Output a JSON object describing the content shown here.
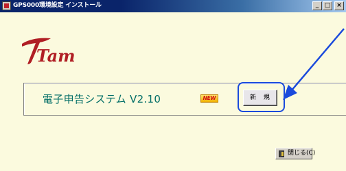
{
  "window": {
    "title": "GPS000環境設定 インストール",
    "minimize_glyph": "_",
    "maximize_glyph": "□",
    "close_glyph": "×"
  },
  "logo": {
    "text": "Tam",
    "color": "#b01e24"
  },
  "product": {
    "name": "電子申告システム V2.10",
    "badge": "NEW"
  },
  "buttons": {
    "new_label": "新 規",
    "close_label": "閉じる(C)"
  },
  "icons": {
    "app": "app-icon",
    "arrow": "blue-arrow-annotation",
    "close": "door-icon"
  },
  "colors": {
    "background": "#fbfade",
    "product_text": "#006d66",
    "highlight": "#1a4adc",
    "titlebar": "#0a246a"
  }
}
